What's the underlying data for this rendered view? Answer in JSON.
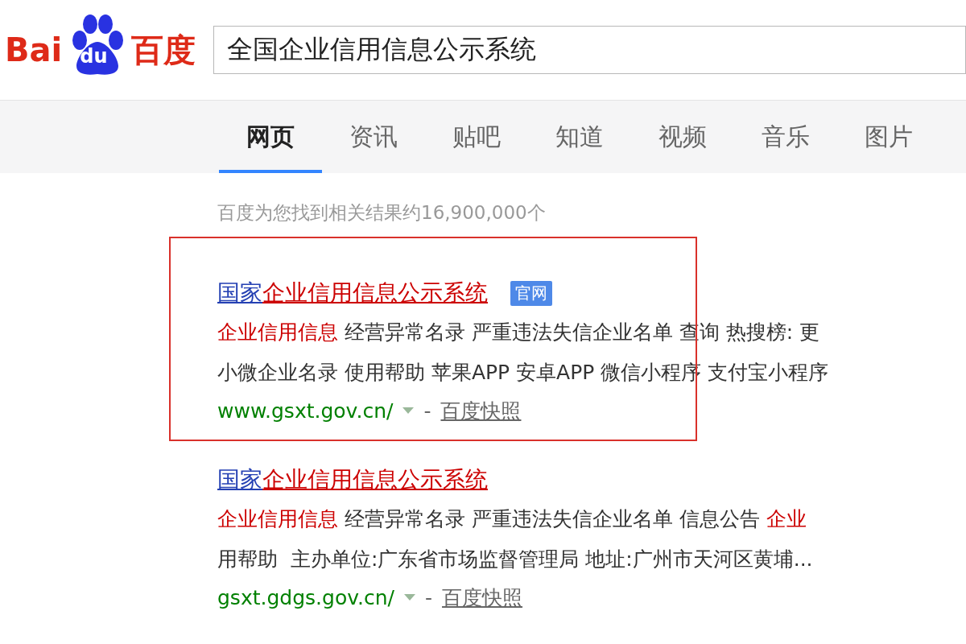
{
  "logo": {
    "latin": "Bai",
    "paw_text": "du",
    "chinese": "百度"
  },
  "search": {
    "value": "全国企业信用信息公示系统"
  },
  "tabs": [
    {
      "label": "网页",
      "selected": true
    },
    {
      "label": "资讯",
      "selected": false
    },
    {
      "label": "贴吧",
      "selected": false
    },
    {
      "label": "知道",
      "selected": false
    },
    {
      "label": "视频",
      "selected": false
    },
    {
      "label": "音乐",
      "selected": false
    },
    {
      "label": "图片",
      "selected": false
    }
  ],
  "result_count": "百度为您找到相关结果约16,900,000个",
  "results": [
    {
      "framed": true,
      "title": [
        {
          "text": "国家",
          "match": false
        },
        {
          "text": "企业信用信息公示系统",
          "match": true
        }
      ],
      "badge": "官网",
      "lines": [
        [
          {
            "text": "企业信用信息",
            "match": true
          },
          {
            "text": " 经营异常名录 严重违法失信企业名单 查询 热搜榜: 更",
            "match": false
          }
        ],
        [
          {
            "text": "小微企业名录 使用帮助 苹果APP 安卓APP 微信小程序 支付宝小程序",
            "match": false
          }
        ]
      ],
      "url": "www.gsxt.gov.cn/",
      "separator": "-",
      "snapshot": "百度快照"
    },
    {
      "title": [
        {
          "text": "国家",
          "match": false
        },
        {
          "text": "企业信用信息公示系统",
          "match": true
        }
      ],
      "lines": [
        [
          {
            "text": "企业信用信息",
            "match": true
          },
          {
            "text": " 经营异常名录 严重违法失信企业名单 信息公告 ",
            "match": false
          },
          {
            "text": "企业",
            "match": true
          }
        ],
        [
          {
            "text": "用帮助  主办单位:广东省市场监督管理局 地址:广州市天河区黄埔...",
            "match": false
          }
        ]
      ],
      "url": "gsxt.gdgs.gov.cn/",
      "separator": "-",
      "snapshot": "百度快照"
    }
  ]
}
